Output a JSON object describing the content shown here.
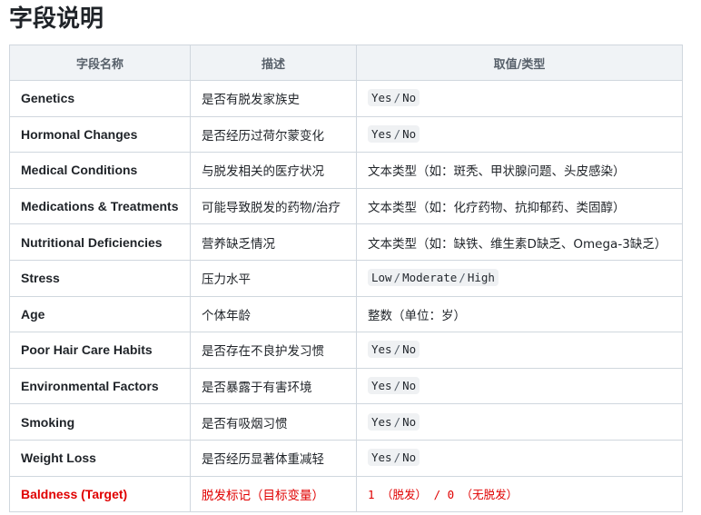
{
  "title": "字段说明",
  "headers": {
    "field": "字段名称",
    "desc": "描述",
    "value": "取值/类型"
  },
  "rows": [
    {
      "field": "Genetics",
      "desc": "是否有脱发家族史",
      "options": [
        "Yes",
        "No"
      ]
    },
    {
      "field": "Hormonal Changes",
      "desc": "是否经历过荷尔蒙变化",
      "options": [
        "Yes",
        "No"
      ]
    },
    {
      "field": "Medical Conditions",
      "desc": "与脱发相关的医疗状况",
      "text": "文本类型（如：斑秃、甲状腺问题、头皮感染）"
    },
    {
      "field": "Medications & Treatments",
      "desc": "可能导致脱发的药物/治疗",
      "text": "文本类型（如：化疗药物、抗抑郁药、类固醇）"
    },
    {
      "field": "Nutritional Deficiencies",
      "desc": "营养缺乏情况",
      "text": "文本类型（如：缺铁、维生素D缺乏、Omega-3缺乏）"
    },
    {
      "field": "Stress",
      "desc": "压力水平",
      "options": [
        "Low",
        "Moderate",
        "High"
      ]
    },
    {
      "field": "Age",
      "desc": "个体年龄",
      "text": "整数（单位：岁）"
    },
    {
      "field": "Poor Hair Care Habits",
      "desc": "是否存在不良护发习惯",
      "options": [
        "Yes",
        "No"
      ]
    },
    {
      "field": "Environmental Factors",
      "desc": "是否暴露于有害环境",
      "options": [
        "Yes",
        "No"
      ]
    },
    {
      "field": "Smoking",
      "desc": "是否有吸烟习惯",
      "options": [
        "Yes",
        "No"
      ]
    },
    {
      "field": "Weight Loss",
      "desc": "是否经历显著体重减轻",
      "options": [
        "Yes",
        "No"
      ]
    },
    {
      "field": "Baldness (Target)",
      "desc": "脱发标记（目标变量）",
      "target_value": "1 （脱发） / 0 （无脱发）",
      "highlight_color": "#e00000"
    }
  ]
}
